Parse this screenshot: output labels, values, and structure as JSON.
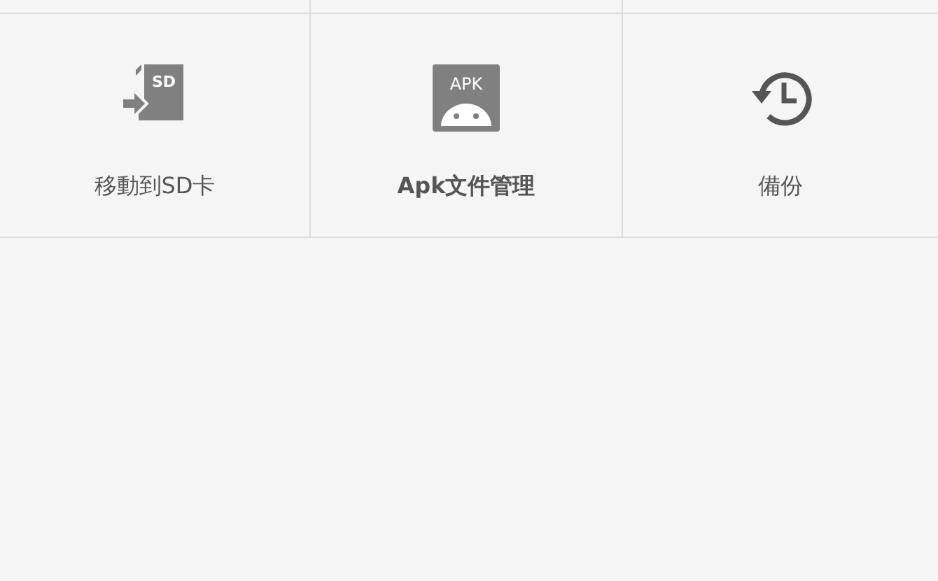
{
  "tiles": [
    {
      "kind": "sd",
      "icon_text": "SD",
      "label": "移動到SD卡"
    },
    {
      "kind": "apk",
      "icon_text": "APK",
      "label": "Apk文件管理"
    },
    {
      "kind": "history",
      "label": "備份"
    }
  ]
}
